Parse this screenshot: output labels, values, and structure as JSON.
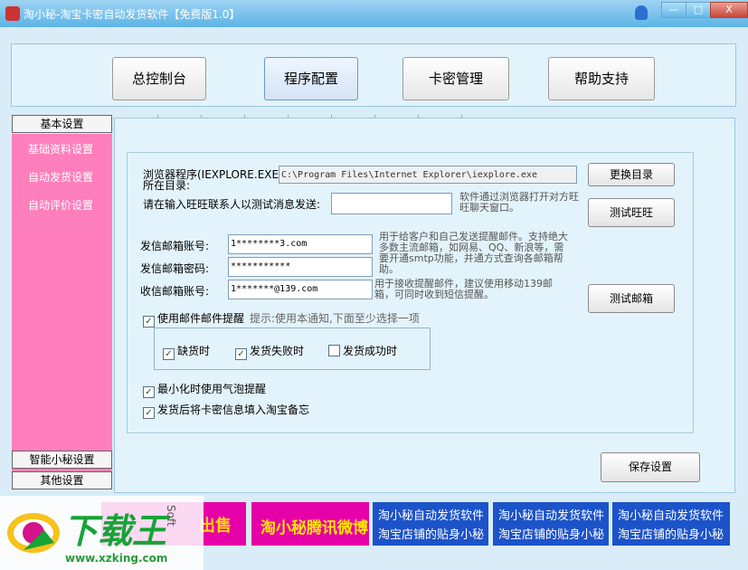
{
  "window": {
    "title": "淘小秘-淘宝卡密自动发货软件【免费版1.0】",
    "min": "—",
    "max": "□",
    "close": "X"
  },
  "topnav": [
    "总控制台",
    "程序配置",
    "卡密管理",
    "帮助支持"
  ],
  "sidebar": {
    "section1": "基本设置",
    "items": [
      "基础资料设置",
      "自动发货设置",
      "自动评价设置"
    ],
    "section2": "智能小秘设置",
    "section3": "其他设置"
  },
  "form": {
    "browser_label_1": "浏览器程序(IEXPLORE.EXE)",
    "browser_label_2": "所在目录:",
    "browser_path": "C:\\Program Files\\Internet Explorer\\iexplore.exe",
    "change_dir_button": "更换目录",
    "wangwang_label": "请在输入旺旺联系人以测试消息发送:",
    "wangwang_value": "",
    "wangwang_note": "软件通过浏览器打开对方旺旺聊天窗口。",
    "test_wangwang_button": "测试旺旺",
    "send_email_label": "发信邮箱账号:",
    "send_email_value": "1********3.com",
    "send_pwd_label": "发信邮箱密码:",
    "send_pwd_value": "***********",
    "recv_email_label": "收信邮箱账号:",
    "recv_email_value": "1*******@139.com",
    "send_note": "用于给客户和自己发送提醒邮件。支持绝大多数主流邮箱，如网易、QQ、新浪等，需要开通smtp功能，并通方式查询各邮箱帮助。",
    "recv_note": "用于接收提醒邮件，建议使用移动139邮箱，可同时收到短信提醒。",
    "test_email_button": "测试邮箱",
    "use_email_label": "使用邮件邮件提醒",
    "use_email_hint": "提示:使用本通知,下面至少选择一项",
    "opt_out_of_stock": "缺货时",
    "opt_ship_fail": "发货失败时",
    "opt_ship_success": "发货成功时",
    "minimize_bubble": "最小化时使用气泡提醒",
    "fill_memo": "发货后将卡密信息填入淘宝备忘",
    "save_button": "保存设置",
    "check": "✓"
  },
  "banners": {
    "b1": "出售",
    "b2": "淘小秘腾讯微博",
    "b3_line1": "淘小秘自动发货软件",
    "b3_line2": "淘宝店铺的贴身小秘",
    "b4_line1": "淘小秘自动发货软件",
    "b4_line2": "淘宝店铺的贴身小秘",
    "b5_line1": "淘小秘自动发货软件",
    "b5_line2": "淘宝店铺的贴身小秘"
  },
  "watermark": {
    "logo_text": "下载王",
    "soft": "Soft",
    "url": "www.xzking.com"
  },
  "colors": {
    "sidebar_pink": "#ff7fbc",
    "banner_magenta": "#e600a8",
    "banner_blue": "#1c53c9",
    "watermark_green": "#17a336"
  }
}
